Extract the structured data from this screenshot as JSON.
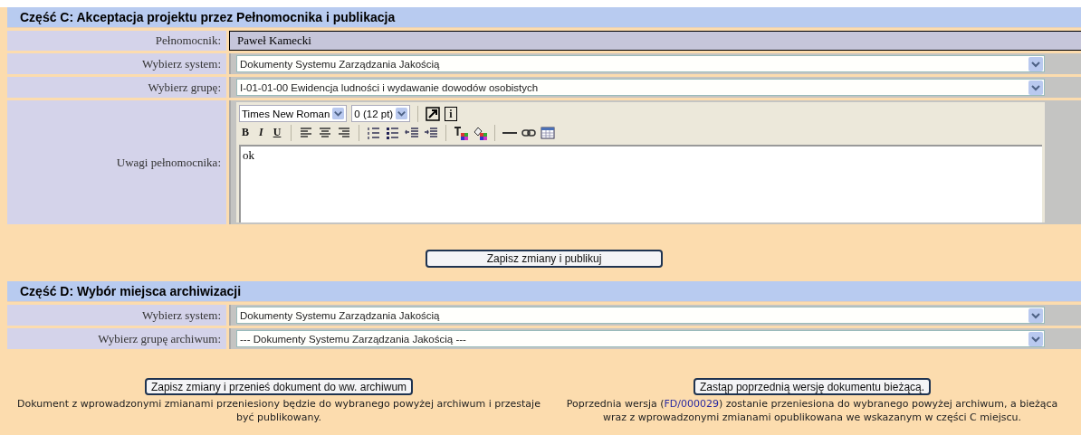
{
  "section_c": {
    "title": "Część C: Akceptacja projektu przez Pełnomocnika i publikacja",
    "proxy": {
      "label": "Pełnomocnik:",
      "value": "Paweł Kamecki"
    },
    "selects": [
      {
        "label": "Wybierz system:",
        "value": "Dokumenty Systemu Zarządzania Jakością"
      },
      {
        "label": "Wybierz grupę:",
        "value": "I-01-01-00 Ewidencja ludności i wydawanie dowodów osobistych"
      }
    ],
    "remarks": {
      "label": "Uwagi pełnomocnika:",
      "font": "Times New Roman",
      "size": "0 (12 pt)",
      "toolbar_top": [
        {
          "kind": "fullscreen"
        },
        {
          "kind": "char",
          "label": "i"
        }
      ],
      "toolbar": [
        {
          "kind": "bold",
          "label": "B"
        },
        {
          "kind": "italic",
          "label": "I"
        },
        {
          "kind": "underline",
          "label": "U"
        },
        {
          "kind": "separator"
        },
        {
          "kind": "align-left"
        },
        {
          "kind": "align-center"
        },
        {
          "kind": "align-right"
        },
        {
          "kind": "separator"
        },
        {
          "kind": "ordered-list"
        },
        {
          "kind": "bullet-list"
        },
        {
          "kind": "outdent"
        },
        {
          "kind": "indent"
        },
        {
          "kind": "separator"
        },
        {
          "kind": "text-color"
        },
        {
          "kind": "bg-color"
        },
        {
          "kind": "separator"
        },
        {
          "kind": "rule"
        },
        {
          "kind": "link"
        },
        {
          "kind": "table"
        }
      ],
      "text": "ok"
    },
    "button": "Zapisz zmiany i publikuj"
  },
  "section_d": {
    "title": "Część D: Wybór miejsca archiwizacji",
    "selects": [
      {
        "label": "Wybierz system:",
        "value": "Dokumenty Systemu Zarządzania Jakością"
      },
      {
        "label": "Wybierz grupę archiwum:",
        "value": "--- Dokumenty Systemu Zarządzania Jakością ---"
      }
    ],
    "actions": [
      {
        "button": "Zapisz zmiany i przenieś dokument do ww. archiwum",
        "note": {
          "before": "Dokument z wprowadzonymi zmianami przeniesiony będzie do wybranego powyżej archiwum i przestaje być publikowany."
        }
      },
      {
        "button": "Zastąp poprzednią wersję dokumentu bieżącą.",
        "note": {
          "before": "Poprzednia wersja (",
          "link": "FD/000029",
          "after": ") zostanie przeniesiona do wybranego powyżej archiwum, a bieżąca wraz z wprowadzonymi zmianami opublikowana we wskazanym w części C miejscu."
        }
      }
    ]
  }
}
